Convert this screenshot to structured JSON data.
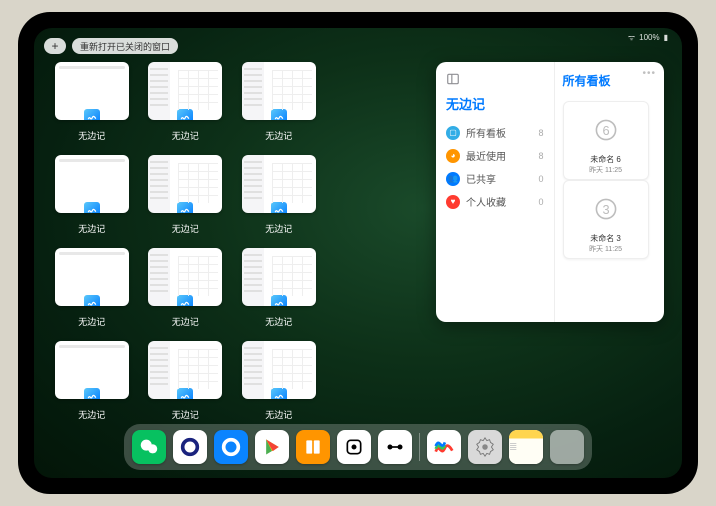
{
  "status": {
    "battery": "100%",
    "wifi": "●●●"
  },
  "topbar": {
    "plus": "+",
    "reopen_label": "重新打开已关闭的窗口"
  },
  "app_name": "无边记",
  "thumbnails": [
    {
      "type": "blank",
      "label": "无边记"
    },
    {
      "type": "list",
      "label": "无边记"
    },
    {
      "type": "list",
      "label": "无边记"
    },
    {
      "type": "blank",
      "label": "无边记"
    },
    {
      "type": "list",
      "label": "无边记"
    },
    {
      "type": "list",
      "label": "无边记"
    },
    {
      "type": "blank",
      "label": "无边记"
    },
    {
      "type": "list",
      "label": "无边记"
    },
    {
      "type": "list",
      "label": "无边记"
    },
    {
      "type": "blank",
      "label": "无边记"
    },
    {
      "type": "list",
      "label": "无边记"
    },
    {
      "type": "list",
      "label": "无边记"
    }
  ],
  "panel": {
    "title": "无边记",
    "right_title": "所有看板",
    "items": [
      {
        "icon_color": "#32ade6",
        "label": "所有看板",
        "count": 8
      },
      {
        "icon_color": "#ff9500",
        "label": "最近使用",
        "count": 8
      },
      {
        "icon_color": "#007aff",
        "label": "已共享",
        "count": 0
      },
      {
        "icon_color": "#ff3b30",
        "label": "个人收藏",
        "count": 0
      }
    ],
    "boards": [
      {
        "glyph": "6",
        "name": "未命名 6",
        "time": "昨天 11:25"
      },
      {
        "glyph": "3",
        "name": "未命名 3",
        "time": "昨天 11:25"
      }
    ]
  },
  "dock": [
    {
      "name": "wechat",
      "bg": "#07c160",
      "glyph": "✳"
    },
    {
      "name": "quark",
      "bg": "#ffffff",
      "glyph": "◯"
    },
    {
      "name": "qqbrowser",
      "bg": "#0a84ff",
      "glyph": "Q"
    },
    {
      "name": "play",
      "bg": "#ffffff",
      "glyph": "▶"
    },
    {
      "name": "books",
      "bg": "#ff9500",
      "glyph": "▮▮"
    },
    {
      "name": "dice",
      "bg": "#ffffff",
      "glyph": "⚀"
    },
    {
      "name": "connect",
      "bg": "#ffffff",
      "glyph": "✱"
    },
    {
      "name": "freeform",
      "bg": "#ffffff",
      "glyph": "〰"
    },
    {
      "name": "settings",
      "bg": "#d9d9d9",
      "glyph": "⚙"
    },
    {
      "name": "notes",
      "bg": "#fff8dc",
      "glyph": "≣"
    }
  ]
}
